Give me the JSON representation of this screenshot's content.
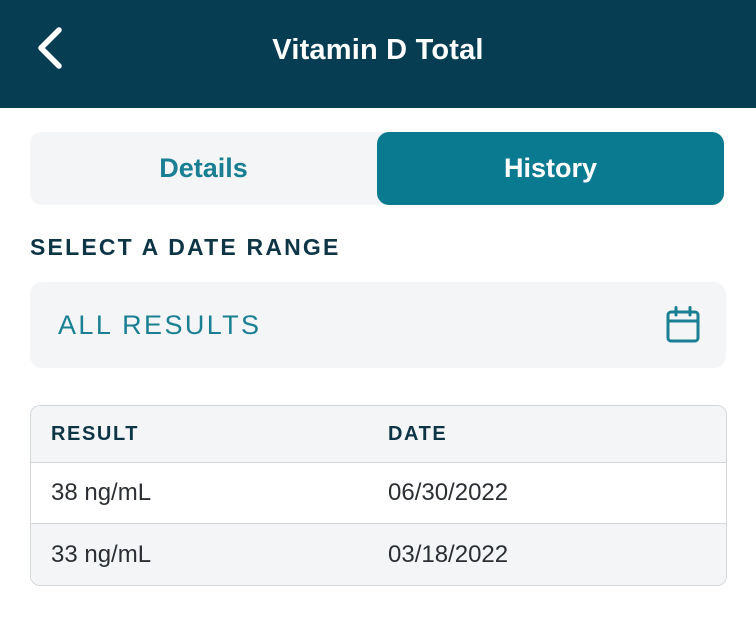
{
  "header": {
    "title": "Vitamin D Total",
    "back_icon": "chevron-left-icon"
  },
  "tabs": [
    {
      "label": "Details",
      "active": false
    },
    {
      "label": "History",
      "active": true
    }
  ],
  "date_range": {
    "section_label": "SELECT A DATE RANGE",
    "value": "ALL RESULTS",
    "icon": "calendar-icon"
  },
  "results": {
    "columns": [
      "RESULT",
      "DATE"
    ],
    "rows": [
      {
        "result": "38 ng/mL",
        "date": "06/30/2022"
      },
      {
        "result": "33 ng/mL",
        "date": "03/18/2022"
      }
    ]
  },
  "colors": {
    "header_bg": "#063d52",
    "accent": "#0a7a91",
    "accent_text": "#1a7f92",
    "surface": "#f3f5f7",
    "label_text": "#0d3546"
  }
}
